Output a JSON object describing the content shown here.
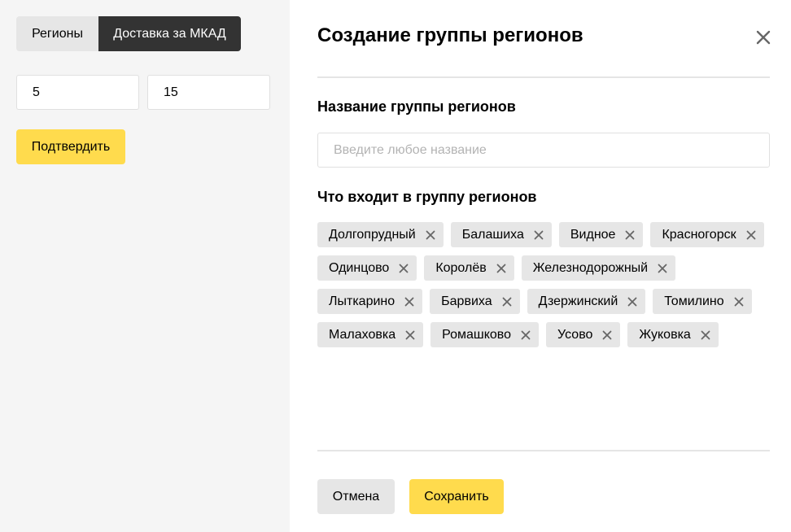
{
  "left": {
    "tabs": [
      {
        "label": "Регионы",
        "active": false
      },
      {
        "label": "Доставка за МКАД",
        "active": true
      }
    ],
    "inputs": [
      "5",
      "15"
    ],
    "confirm_label": "Подтвердить"
  },
  "modal": {
    "title": "Создание группы регионов",
    "close_icon": "close-icon",
    "name_label": "Название группы регионов",
    "name_value": "",
    "name_placeholder": "Введите любое название",
    "regions_label": "Что входит в группу регионов",
    "regions": [
      "Долгопрудный",
      "Балашиха",
      "Видное",
      "Красногорск",
      "Одинцово",
      "Королёв",
      "Железнодорожный",
      "Лыткарино",
      "Барвиха",
      "Дзержинский",
      "Томилино",
      "Малаховка",
      "Ромашково",
      "Усово",
      "Жуковка"
    ],
    "cancel_label": "Отмена",
    "save_label": "Сохранить"
  },
  "colors": {
    "accent": "#ffdb4d",
    "dark": "#333333",
    "panel_bg": "#f5f5f5",
    "tag_bg": "#e6e6e6"
  }
}
